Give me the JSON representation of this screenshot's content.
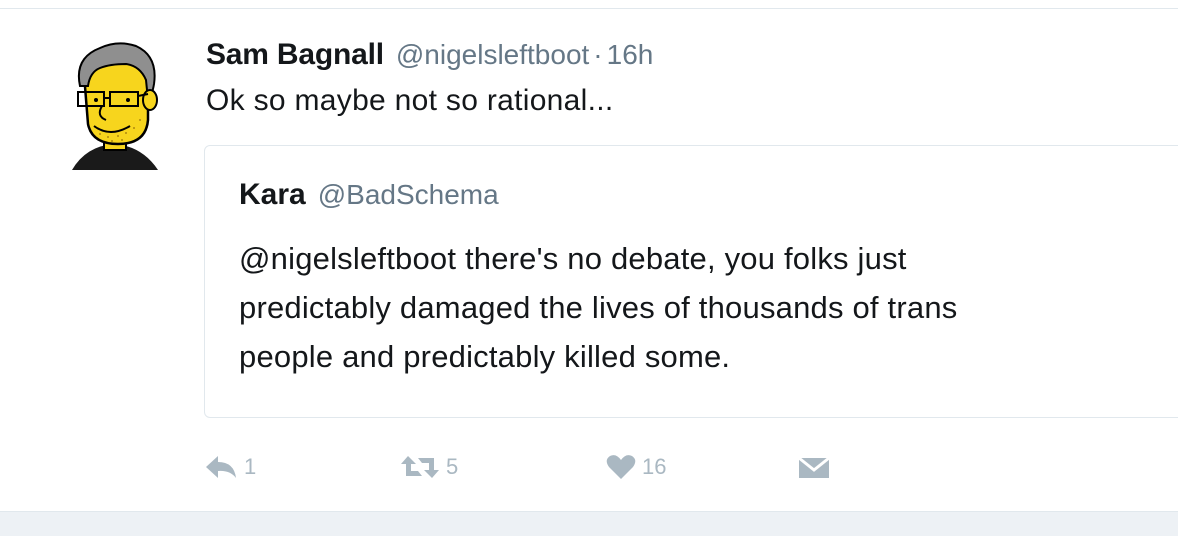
{
  "tweet": {
    "author_name": "Sam Bagnall",
    "author_handle": "@nigelsleftboot",
    "separator": "·",
    "time": "16h",
    "text": "Ok so maybe not so rational...",
    "avatar_icon": "cartoon-avatar-icon"
  },
  "quoted_tweet": {
    "author_name": "Kara",
    "author_handle": "@BadSchema",
    "text_lines": [
      "@nigelsleftboot there's no debate, you folks just",
      "predictably damaged the lives of thousands of trans",
      "people and predictably killed some."
    ]
  },
  "actions": {
    "reply": {
      "icon": "reply-icon",
      "count": "1"
    },
    "retweet": {
      "icon": "retweet-icon",
      "count": "5"
    },
    "like": {
      "icon": "heart-icon",
      "count": "16"
    },
    "message": {
      "icon": "envelope-icon"
    }
  },
  "colors": {
    "text": "#14171a",
    "secondary": "#657786",
    "action_gray": "#aab8c2",
    "border": "#e1e8ed",
    "footer_bg": "#edf1f5",
    "avatar_skin": "#f7d51d"
  }
}
